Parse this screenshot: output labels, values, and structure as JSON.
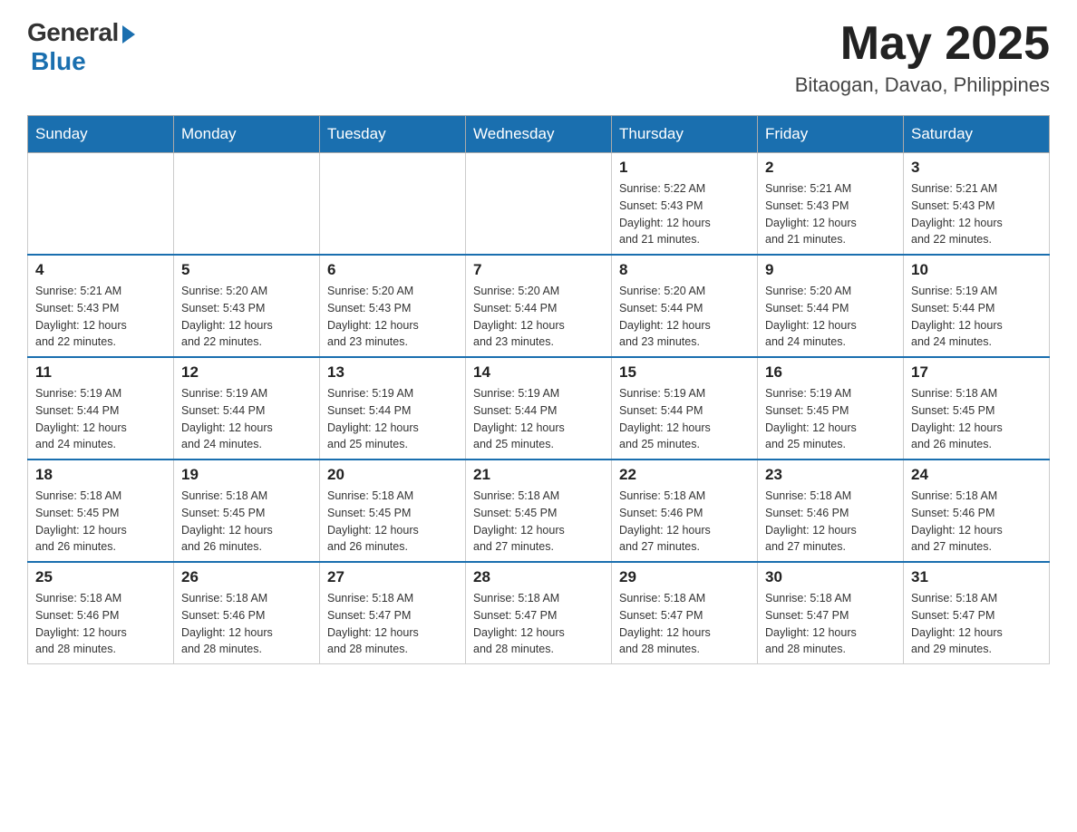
{
  "header": {
    "logo": {
      "general": "General",
      "blue": "Blue"
    },
    "month_year": "May 2025",
    "location": "Bitaogan, Davao, Philippines"
  },
  "days_of_week": [
    "Sunday",
    "Monday",
    "Tuesday",
    "Wednesday",
    "Thursday",
    "Friday",
    "Saturday"
  ],
  "weeks": [
    [
      {
        "day": "",
        "info": ""
      },
      {
        "day": "",
        "info": ""
      },
      {
        "day": "",
        "info": ""
      },
      {
        "day": "",
        "info": ""
      },
      {
        "day": "1",
        "info": "Sunrise: 5:22 AM\nSunset: 5:43 PM\nDaylight: 12 hours\nand 21 minutes."
      },
      {
        "day": "2",
        "info": "Sunrise: 5:21 AM\nSunset: 5:43 PM\nDaylight: 12 hours\nand 21 minutes."
      },
      {
        "day": "3",
        "info": "Sunrise: 5:21 AM\nSunset: 5:43 PM\nDaylight: 12 hours\nand 22 minutes."
      }
    ],
    [
      {
        "day": "4",
        "info": "Sunrise: 5:21 AM\nSunset: 5:43 PM\nDaylight: 12 hours\nand 22 minutes."
      },
      {
        "day": "5",
        "info": "Sunrise: 5:20 AM\nSunset: 5:43 PM\nDaylight: 12 hours\nand 22 minutes."
      },
      {
        "day": "6",
        "info": "Sunrise: 5:20 AM\nSunset: 5:43 PM\nDaylight: 12 hours\nand 23 minutes."
      },
      {
        "day": "7",
        "info": "Sunrise: 5:20 AM\nSunset: 5:44 PM\nDaylight: 12 hours\nand 23 minutes."
      },
      {
        "day": "8",
        "info": "Sunrise: 5:20 AM\nSunset: 5:44 PM\nDaylight: 12 hours\nand 23 minutes."
      },
      {
        "day": "9",
        "info": "Sunrise: 5:20 AM\nSunset: 5:44 PM\nDaylight: 12 hours\nand 24 minutes."
      },
      {
        "day": "10",
        "info": "Sunrise: 5:19 AM\nSunset: 5:44 PM\nDaylight: 12 hours\nand 24 minutes."
      }
    ],
    [
      {
        "day": "11",
        "info": "Sunrise: 5:19 AM\nSunset: 5:44 PM\nDaylight: 12 hours\nand 24 minutes."
      },
      {
        "day": "12",
        "info": "Sunrise: 5:19 AM\nSunset: 5:44 PM\nDaylight: 12 hours\nand 24 minutes."
      },
      {
        "day": "13",
        "info": "Sunrise: 5:19 AM\nSunset: 5:44 PM\nDaylight: 12 hours\nand 25 minutes."
      },
      {
        "day": "14",
        "info": "Sunrise: 5:19 AM\nSunset: 5:44 PM\nDaylight: 12 hours\nand 25 minutes."
      },
      {
        "day": "15",
        "info": "Sunrise: 5:19 AM\nSunset: 5:44 PM\nDaylight: 12 hours\nand 25 minutes."
      },
      {
        "day": "16",
        "info": "Sunrise: 5:19 AM\nSunset: 5:45 PM\nDaylight: 12 hours\nand 25 minutes."
      },
      {
        "day": "17",
        "info": "Sunrise: 5:18 AM\nSunset: 5:45 PM\nDaylight: 12 hours\nand 26 minutes."
      }
    ],
    [
      {
        "day": "18",
        "info": "Sunrise: 5:18 AM\nSunset: 5:45 PM\nDaylight: 12 hours\nand 26 minutes."
      },
      {
        "day": "19",
        "info": "Sunrise: 5:18 AM\nSunset: 5:45 PM\nDaylight: 12 hours\nand 26 minutes."
      },
      {
        "day": "20",
        "info": "Sunrise: 5:18 AM\nSunset: 5:45 PM\nDaylight: 12 hours\nand 26 minutes."
      },
      {
        "day": "21",
        "info": "Sunrise: 5:18 AM\nSunset: 5:45 PM\nDaylight: 12 hours\nand 27 minutes."
      },
      {
        "day": "22",
        "info": "Sunrise: 5:18 AM\nSunset: 5:46 PM\nDaylight: 12 hours\nand 27 minutes."
      },
      {
        "day": "23",
        "info": "Sunrise: 5:18 AM\nSunset: 5:46 PM\nDaylight: 12 hours\nand 27 minutes."
      },
      {
        "day": "24",
        "info": "Sunrise: 5:18 AM\nSunset: 5:46 PM\nDaylight: 12 hours\nand 27 minutes."
      }
    ],
    [
      {
        "day": "25",
        "info": "Sunrise: 5:18 AM\nSunset: 5:46 PM\nDaylight: 12 hours\nand 28 minutes."
      },
      {
        "day": "26",
        "info": "Sunrise: 5:18 AM\nSunset: 5:46 PM\nDaylight: 12 hours\nand 28 minutes."
      },
      {
        "day": "27",
        "info": "Sunrise: 5:18 AM\nSunset: 5:47 PM\nDaylight: 12 hours\nand 28 minutes."
      },
      {
        "day": "28",
        "info": "Sunrise: 5:18 AM\nSunset: 5:47 PM\nDaylight: 12 hours\nand 28 minutes."
      },
      {
        "day": "29",
        "info": "Sunrise: 5:18 AM\nSunset: 5:47 PM\nDaylight: 12 hours\nand 28 minutes."
      },
      {
        "day": "30",
        "info": "Sunrise: 5:18 AM\nSunset: 5:47 PM\nDaylight: 12 hours\nand 28 minutes."
      },
      {
        "day": "31",
        "info": "Sunrise: 5:18 AM\nSunset: 5:47 PM\nDaylight: 12 hours\nand 29 minutes."
      }
    ]
  ]
}
